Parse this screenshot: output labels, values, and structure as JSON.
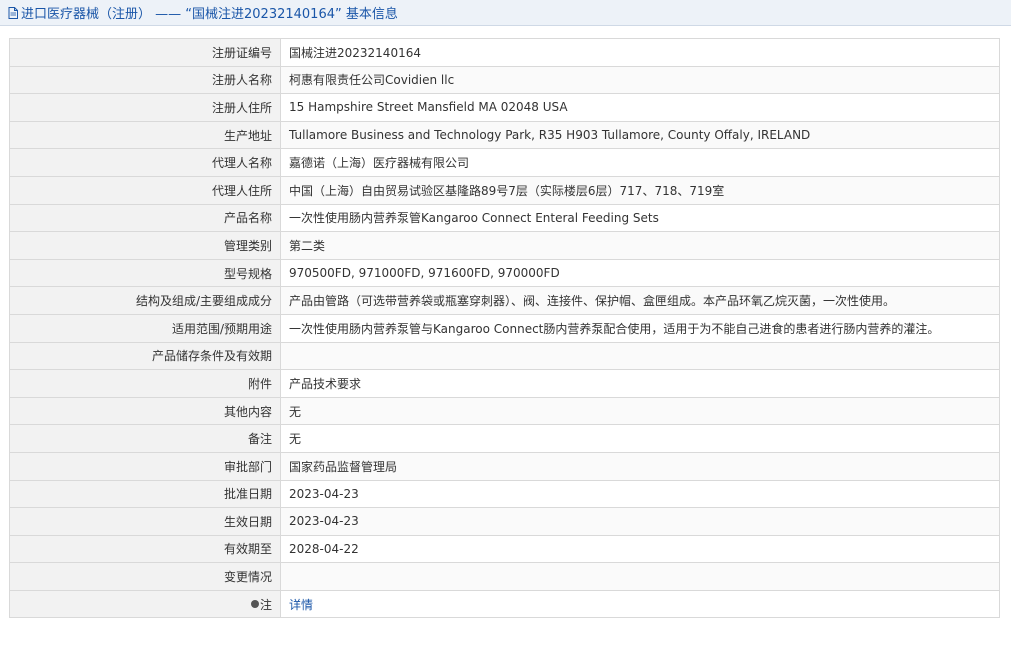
{
  "header": {
    "title": "进口医疗器械（注册） ——  “国械注进20232140164” 基本信息",
    "icon": "document-icon"
  },
  "rows": [
    {
      "label": "注册证编号",
      "value": "国械注进20232140164"
    },
    {
      "label": "注册人名称",
      "value": "柯惠有限责任公司Covidien llc"
    },
    {
      "label": "注册人住所",
      "value": "15 Hampshire Street Mansfield MA 02048 USA"
    },
    {
      "label": "生产地址",
      "value": "Tullamore Business and Technology Park, R35 H903 Tullamore, County Offaly, IRELAND"
    },
    {
      "label": "代理人名称",
      "value": "嘉德诺（上海）医疗器械有限公司"
    },
    {
      "label": "代理人住所",
      "value": "中国（上海）自由贸易试验区基隆路89号7层（实际楼层6层）717、718、719室"
    },
    {
      "label": "产品名称",
      "value": "一次性使用肠内营养泵管Kangaroo Connect Enteral Feeding Sets"
    },
    {
      "label": "管理类别",
      "value": "第二类"
    },
    {
      "label": "型号规格",
      "value": "970500FD, 971000FD, 971600FD, 970000FD"
    },
    {
      "label": "结构及组成/主要组成成分",
      "value": "产品由管路（可选带营养袋或瓶塞穿刺器）、阀、连接件、保护帽、盒匣组成。本产品环氧乙烷灭菌，一次性使用。"
    },
    {
      "label": "适用范围/预期用途",
      "value": "一次性使用肠内营养泵管与Kangaroo Connect肠内营养泵配合使用，适用于为不能自己进食的患者进行肠内营养的灌注。"
    },
    {
      "label": "产品储存条件及有效期",
      "value": ""
    },
    {
      "label": "附件",
      "value": "产品技术要求"
    },
    {
      "label": "其他内容",
      "value": "无"
    },
    {
      "label": "备注",
      "value": "无"
    },
    {
      "label": "审批部门",
      "value": "国家药品监督管理局"
    },
    {
      "label": "批准日期",
      "value": "2023-04-23"
    },
    {
      "label": "生效日期",
      "value": "2023-04-23"
    },
    {
      "label": "有效期至",
      "value": "2028-04-22"
    },
    {
      "label": "变更情况",
      "value": ""
    }
  ],
  "note_row": {
    "label": "注",
    "icon": "pin-icon",
    "link_text": "详情"
  },
  "colors": {
    "accent": "#1a56a8",
    "label_bg": "#f2f2f2",
    "border": "#d9d9d9",
    "header_bg": "#edf2f8"
  }
}
